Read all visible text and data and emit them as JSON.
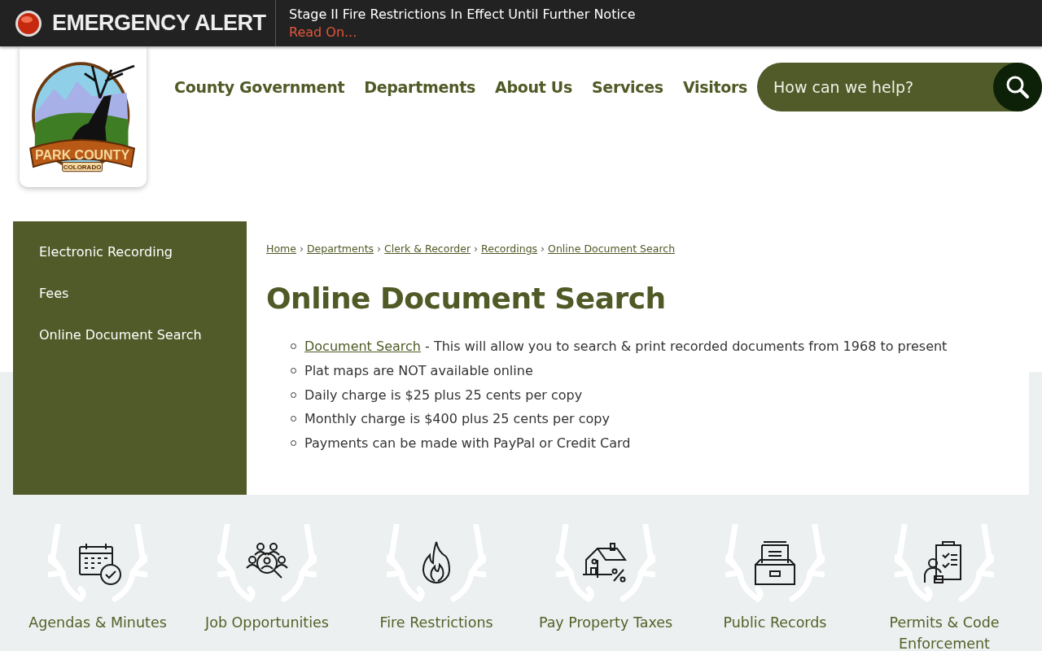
{
  "alert": {
    "title": "EMERGENCY ALERT",
    "message": "Stage II Fire Restrictions In Effect Until Further Notice",
    "link": "Read On..."
  },
  "logo": {
    "name": "PARK COUNTY",
    "state": "COLORADO"
  },
  "nav": [
    "County Government",
    "Departments",
    "About Us",
    "Services",
    "Visitors"
  ],
  "search": {
    "placeholder": "How can we help?"
  },
  "sidebar": {
    "items": [
      "Electronic Recording",
      "Fees",
      "Online Document Search"
    ]
  },
  "breadcrumb_separator": "›",
  "breadcrumbs": [
    "Home",
    "Departments",
    "Clerk & Recorder",
    "Recordings",
    "Online Document Search"
  ],
  "title": "Online Document Search",
  "items": [
    {
      "link": "Document Search",
      "text": " - This will allow you to search & print recorded documents from 1968 to present"
    },
    {
      "text": "Plat maps are NOT available online"
    },
    {
      "text": "Daily charge is $25 plus 25 cents per copy"
    },
    {
      "text": "Monthly charge is $400 plus 25 cents per copy"
    },
    {
      "text": "Payments can be made with PayPal or Credit Card"
    }
  ],
  "quick_links": [
    {
      "kind": "calendar",
      "label": "Agendas & Minutes"
    },
    {
      "kind": "people",
      "label": "Job Opportunities"
    },
    {
      "kind": "fire",
      "label": "Fire Restrictions"
    },
    {
      "kind": "house",
      "label": "Pay Property Taxes"
    },
    {
      "kind": "drawer",
      "label": "Public Records"
    },
    {
      "kind": "clipboard",
      "label": "Permits & Code Enforcement"
    }
  ]
}
